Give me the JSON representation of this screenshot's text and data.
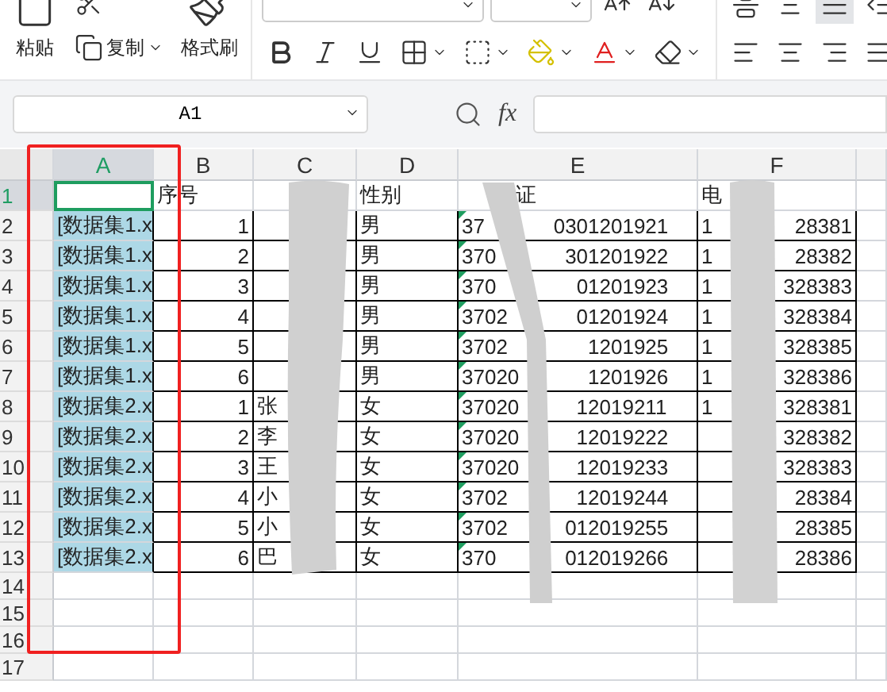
{
  "ribbon": {
    "paste": "粘贴",
    "copy": "复制",
    "format_painter": "格式刷"
  },
  "name_box": "A1",
  "fx": "fx",
  "columns": [
    {
      "label": "A",
      "selected": true
    },
    {
      "label": "B",
      "selected": false
    },
    {
      "label": "C",
      "selected": false
    },
    {
      "label": "D",
      "selected": false
    },
    {
      "label": "E",
      "selected": false
    },
    {
      "label": "F",
      "selected": false
    }
  ],
  "header_row": {
    "number": "1",
    "selected": true,
    "b": "序号",
    "d": "性别",
    "e": "证",
    "f": "电"
  },
  "rows": [
    {
      "number": "2",
      "selected": false,
      "a": "[数据集1.x",
      "b": "1",
      "d": "男",
      "e_start": "37",
      "e_end": "0301201921",
      "f_start": "1",
      "f_end": "28381"
    },
    {
      "number": "3",
      "selected": false,
      "a": "[数据集1.x",
      "b": "2",
      "d": "男",
      "e_start": "370",
      "e_end": "301201922",
      "f_start": "1",
      "f_end": "28382"
    },
    {
      "number": "4",
      "selected": false,
      "a": "[数据集1.x",
      "b": "3",
      "d": "男",
      "e_start": "370",
      "e_end": "01201923",
      "f_start": "1",
      "f_end": "328383"
    },
    {
      "number": "5",
      "selected": false,
      "a": "[数据集1.x",
      "b": "4",
      "d": "男",
      "e_start": "3702",
      "e_end": "01201924",
      "f_start": "1",
      "f_end": "328384"
    },
    {
      "number": "6",
      "selected": false,
      "a": "[数据集1.x",
      "b": "5",
      "d": "男",
      "e_start": "3702",
      "e_end": "1201925",
      "f_start": "1",
      "f_end": "328385"
    },
    {
      "number": "7",
      "selected": false,
      "a": "[数据集1.x",
      "b": "6",
      "d": "男",
      "e_start": "37020",
      "e_end": "1201926",
      "f_start": "1",
      "f_end": "328386"
    },
    {
      "number": "8",
      "selected": false,
      "a": "[数据集2.x",
      "b": "1",
      "c": "张",
      "d": "女",
      "e_start": "37020",
      "e_end": "12019211",
      "f_start": "1",
      "f_end": "328381"
    },
    {
      "number": "9",
      "selected": false,
      "a": "[数据集2.x",
      "b": "2",
      "c": "李",
      "d": "女",
      "e_start": "37020",
      "e_end": "12019222",
      "f_end": "328382"
    },
    {
      "number": "10",
      "selected": false,
      "a": "[数据集2.x",
      "b": "3",
      "c": "王",
      "d": "女",
      "e_start": "37020",
      "e_end": "12019233",
      "f_end": "328383"
    },
    {
      "number": "11",
      "selected": false,
      "a": "[数据集2.x",
      "b": "4",
      "c": "小",
      "d": "女",
      "e_start": "3702",
      "e_end": "12019244",
      "f_end": "28384"
    },
    {
      "number": "12",
      "selected": false,
      "a": "[数据集2.x",
      "b": "5",
      "c": "小",
      "d": "女",
      "e_start": "3702",
      "e_end": "012019255",
      "f_end": "28385"
    },
    {
      "number": "13",
      "selected": false,
      "a": "[数据集2.x",
      "b": "6",
      "c": "巴",
      "d": "女",
      "e_start": "370",
      "e_end": "012019266",
      "f_end": "28386"
    }
  ],
  "empty_rows": [
    {
      "number": "14",
      "selected": false
    },
    {
      "number": "15",
      "selected": false
    },
    {
      "number": "16",
      "selected": false
    },
    {
      "number": "17",
      "selected": false
    }
  ]
}
